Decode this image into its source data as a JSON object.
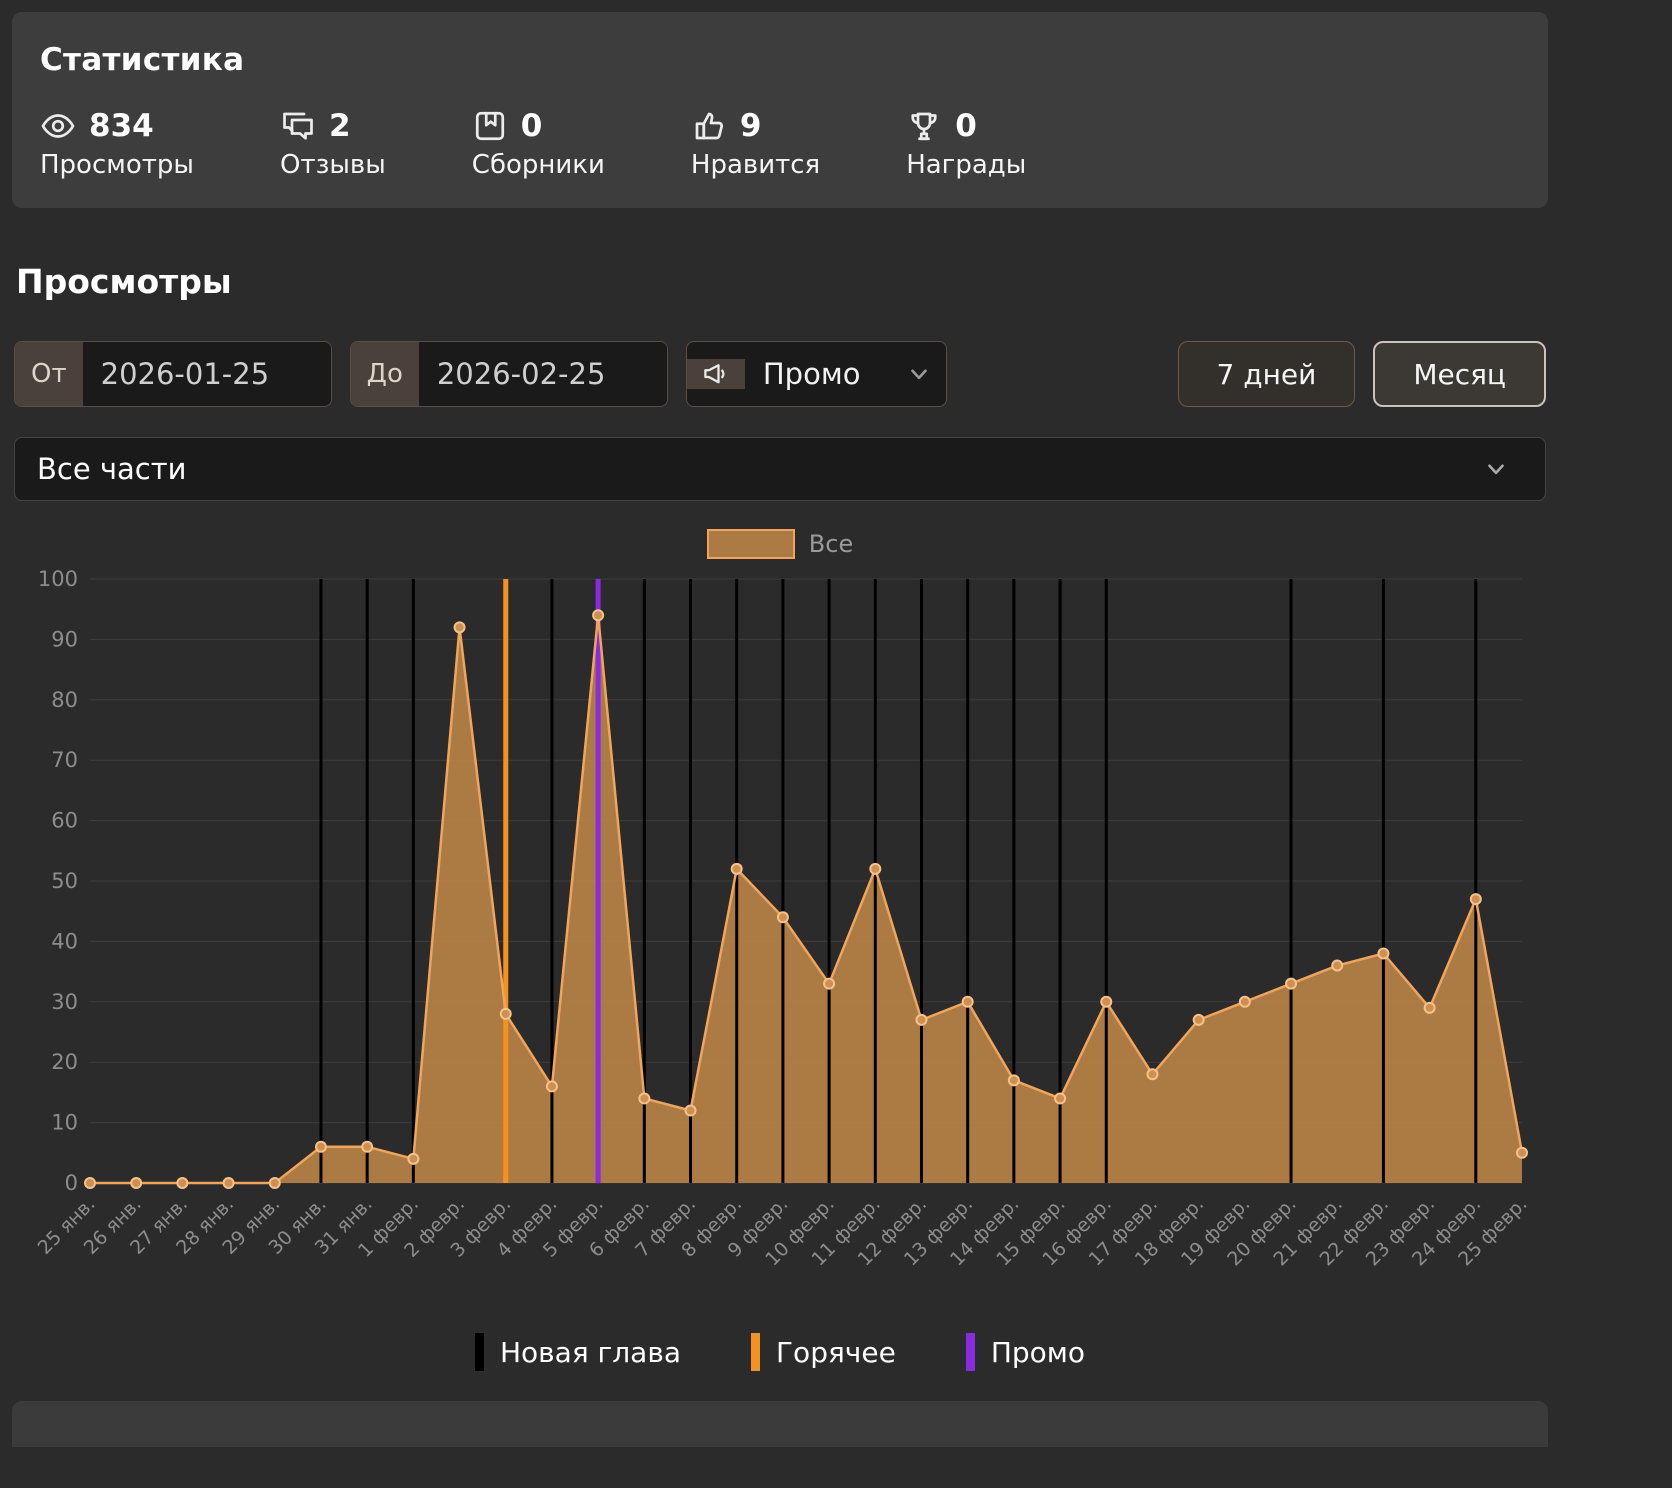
{
  "stats": {
    "title": "Статистика",
    "items": [
      {
        "icon": "eye-icon",
        "value": "834",
        "label": "Просмотры"
      },
      {
        "icon": "comments-icon",
        "value": "2",
        "label": "Отзывы"
      },
      {
        "icon": "collections-icon",
        "value": "0",
        "label": "Сборники"
      },
      {
        "icon": "thumbs-up-icon",
        "value": "9",
        "label": "Нравится"
      },
      {
        "icon": "trophy-icon",
        "value": "0",
        "label": "Награды"
      }
    ]
  },
  "views": {
    "title": "Просмотры",
    "from_label": "От",
    "from_value": "2026-01-25",
    "to_label": "До",
    "to_value": "2026-02-25",
    "marker_filter_value": "Промо",
    "btn_7days": "7 дней",
    "btn_month": "Месяц",
    "parts_select_value": "Все части"
  },
  "chart_data": {
    "type": "area",
    "title": "",
    "xlabel": "",
    "ylabel": "",
    "ylim": [
      0,
      100
    ],
    "yticks": [
      0,
      10,
      20,
      30,
      40,
      50,
      60,
      70,
      80,
      90,
      100
    ],
    "grid": "horizontal",
    "legend_position": "top",
    "categories": [
      "25 янв.",
      "26 янв.",
      "27 янв.",
      "28 янв.",
      "29 янв.",
      "30 янв.",
      "31 янв.",
      "1 февр.",
      "2 февр.",
      "3 февр.",
      "4 февр.",
      "5 февр.",
      "6 февр.",
      "7 февр.",
      "8 февр.",
      "9 февр.",
      "10 февр.",
      "11 февр.",
      "12 февр.",
      "13 февр.",
      "14 февр.",
      "15 февр.",
      "16 февр.",
      "17 февр.",
      "18 февр.",
      "19 февр.",
      "20 февр.",
      "21 февр.",
      "22 февр.",
      "23 февр.",
      "24 февр.",
      "25 февр."
    ],
    "series": [
      {
        "name": "Все",
        "values": [
          0,
          0,
          0,
          0,
          0,
          6,
          6,
          4,
          92,
          28,
          16,
          94,
          14,
          12,
          52,
          44,
          33,
          52,
          27,
          30,
          17,
          14,
          30,
          18,
          27,
          30,
          33,
          36,
          38,
          29,
          47,
          5
        ]
      }
    ],
    "markers": {
      "new_chapter": {
        "label": "Новая глава",
        "color": "#000000",
        "days": [
          "30 янв.",
          "31 янв.",
          "1 февр.",
          "4 февр.",
          "6 февр.",
          "7 февр.",
          "8 февр.",
          "9 февр.",
          "10 февр.",
          "11 февр.",
          "12 февр.",
          "13 февр.",
          "14 февр.",
          "15 февр.",
          "16 февр.",
          "20 февр.",
          "22 февр.",
          "24 февр."
        ]
      },
      "hot": {
        "label": "Горячее",
        "color": "#f5921e",
        "days": [
          "3 февр."
        ]
      },
      "promo": {
        "label": "Промо",
        "color": "#8a2be2",
        "days": [
          "5 февр."
        ]
      }
    },
    "colors": {
      "fill": "rgba(195,136,72,0.85)",
      "line": "#f0a55c",
      "point": "#cd9052",
      "point_stroke": "#f6c289",
      "grid": "#3d3d3d",
      "axis_text": "#8d8d8d"
    }
  }
}
